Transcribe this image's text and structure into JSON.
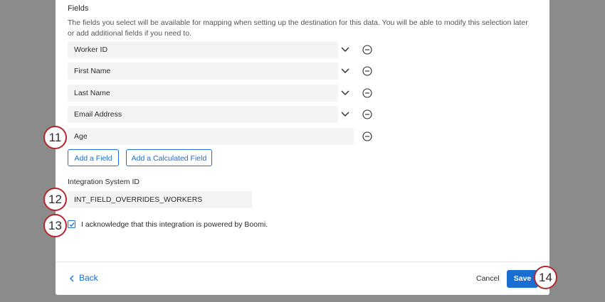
{
  "fields_section": {
    "title": "Fields",
    "description": "The fields you select will be available for mapping when setting up the destination for this data. You will be able to modify this selection later or add additional fields if you need to.",
    "rows": [
      {
        "value": "Worker ID",
        "icon": "chevron-down-icon"
      },
      {
        "value": "First Name",
        "icon": "chevron-down-icon"
      },
      {
        "value": "Last Name",
        "icon": "chevron-down-icon"
      },
      {
        "value": "Email Address",
        "icon": "chevron-down-icon"
      },
      {
        "value": "Age"
      }
    ],
    "add_field_label": "Add a Field",
    "add_calculated_field_label": "Add a Calculated Field"
  },
  "integration": {
    "label": "Integration System ID",
    "value": "INT_FIELD_OVERRIDES_WORKERS"
  },
  "acknowledgement": {
    "checked": true,
    "text": "I acknowledge that this integration is powered by Boomi."
  },
  "footer": {
    "back_label": "Back",
    "cancel_label": "Cancel",
    "save_label": "Save"
  },
  "markers": [
    "11",
    "12",
    "13",
    "14"
  ],
  "colors": {
    "accent": "#1a6ed1",
    "marker_ring": "#b5272c",
    "overlay": "#8b8b8b"
  }
}
